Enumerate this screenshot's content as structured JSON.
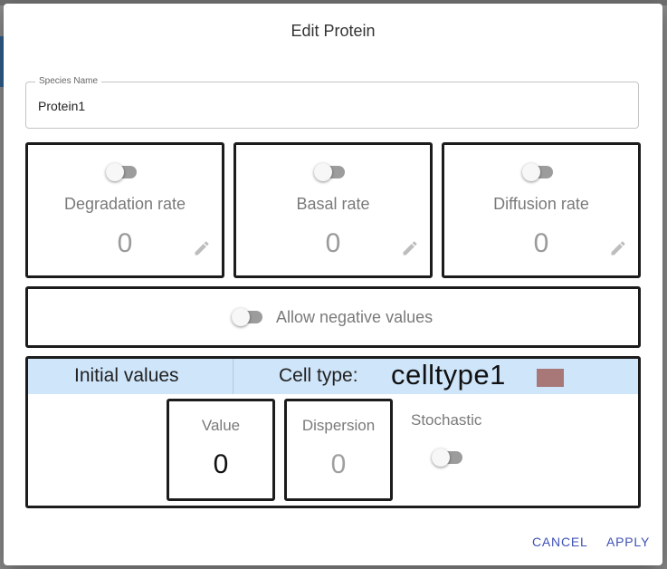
{
  "dialog": {
    "title": "Edit Protein"
  },
  "species_name": {
    "label": "Species Name",
    "value": "Protein1"
  },
  "rates": [
    {
      "label": "Degradation rate",
      "value": "0",
      "enabled": false
    },
    {
      "label": "Basal rate",
      "value": "0",
      "enabled": false
    },
    {
      "label": "Diffusion rate",
      "value": "0",
      "enabled": false
    }
  ],
  "negative": {
    "label": "Allow negative values",
    "enabled": false
  },
  "initial": {
    "title": "Initial values",
    "celltype_label": "Cell type:",
    "celltype_name": "celltype1",
    "celltype_color": "#a87878",
    "value_label": "Value",
    "value": "0",
    "dispersion_label": "Dispersion",
    "dispersion": "0",
    "stochastic_label": "Stochastic",
    "stochastic_enabled": false
  },
  "actions": {
    "cancel": "CANCEL",
    "apply": "APPLY"
  },
  "colors": {
    "accent": "#3f51b5",
    "header_bg": "#cfe5fa",
    "border": "#1c1c1c"
  }
}
